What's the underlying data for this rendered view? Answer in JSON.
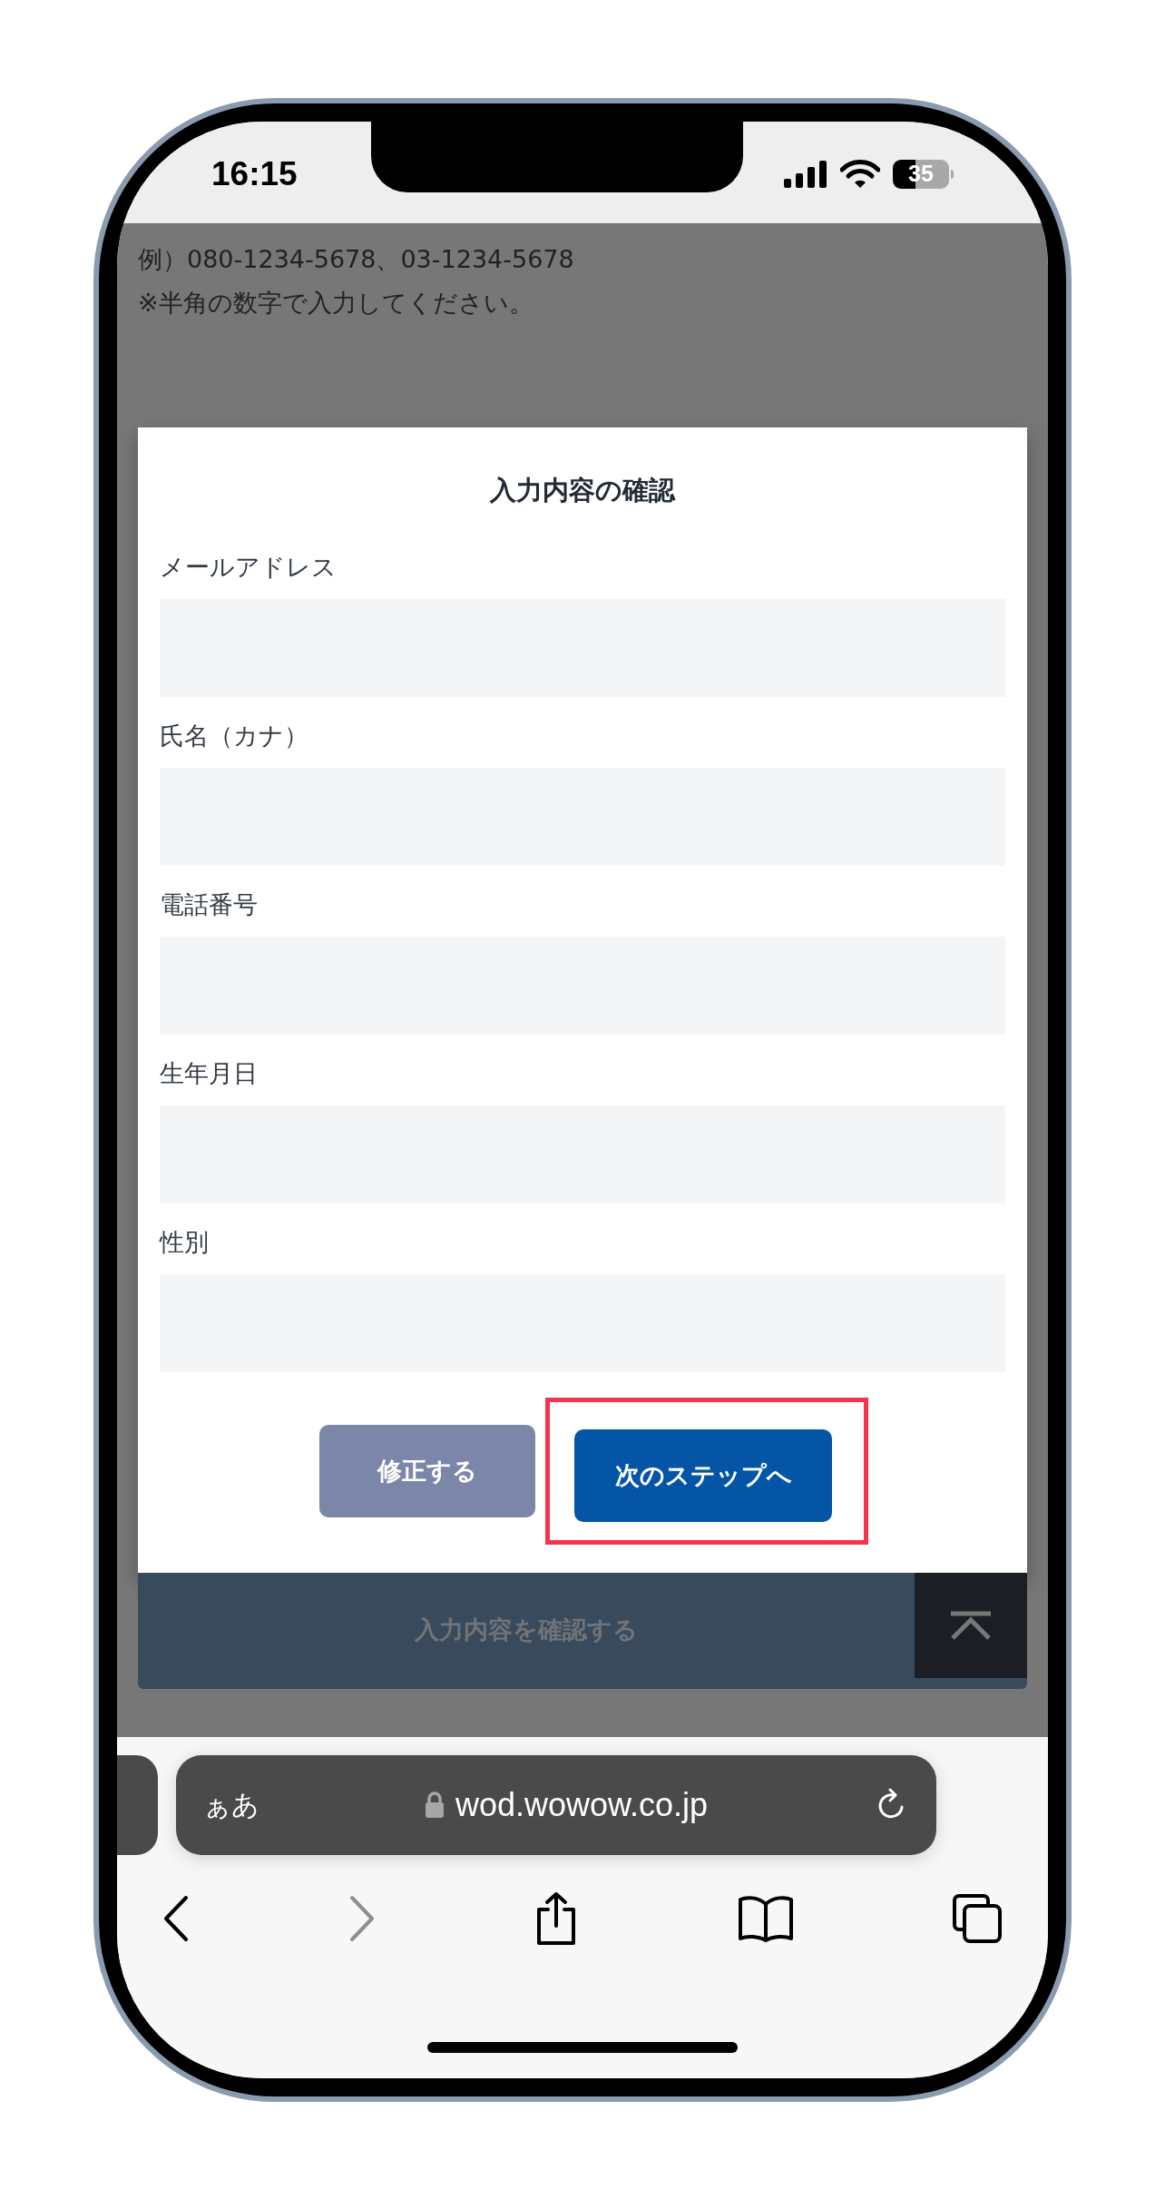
{
  "status_bar": {
    "time": "16:15",
    "battery": "35"
  },
  "page": {
    "hint_lines": [
      "例）080-1234-5678、03-1234-5678",
      "※半角の数字で入力してください。"
    ],
    "submit_button": "入力内容を確認する"
  },
  "dialog": {
    "title": "入力内容の確認",
    "fields": [
      {
        "label": "メールアドレス"
      },
      {
        "label": "氏名（カナ）"
      },
      {
        "label": "電話番号"
      },
      {
        "label": "生年月日"
      },
      {
        "label": "性別"
      }
    ],
    "buttons": [
      {
        "label": "修正する",
        "kind": "secondary",
        "highlighted": false
      },
      {
        "label": "次のステップへ",
        "kind": "primary",
        "highlighted": true
      }
    ]
  },
  "browser": {
    "text_size_button": "ぁあ",
    "url": "wod.wowow.co.jp"
  }
}
